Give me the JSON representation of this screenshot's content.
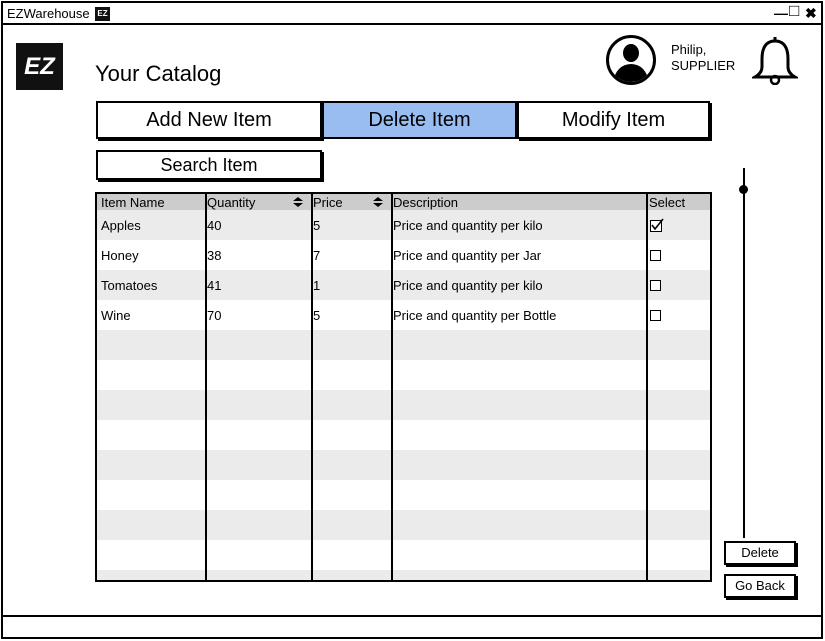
{
  "window": {
    "title": "EZWarehouse",
    "title_logo": "EZ",
    "minimize_glyph": "—",
    "maximize_glyph": "□",
    "close_glyph": "✖"
  },
  "header": {
    "logo": "EZ",
    "title": "Your Catalog",
    "user_name": "Philip,",
    "user_role": "SUPPLIER"
  },
  "actions": {
    "add": "Add New Item",
    "delete": "Delete Item",
    "modify": "Modify Item",
    "active": "delete"
  },
  "search": {
    "label": "Search Item"
  },
  "table": {
    "columns": [
      "Item Name",
      "Quantity",
      "Price",
      "Description",
      "Select"
    ],
    "sortable": [
      "Quantity",
      "Price"
    ],
    "rows": [
      {
        "name": "Apples",
        "quantity": "40",
        "price": "5",
        "description": "Price and quantity per kilo",
        "selected": true
      },
      {
        "name": "Honey",
        "quantity": "38",
        "price": "7",
        "description": "Price and quantity per Jar",
        "selected": false
      },
      {
        "name": "Tomatoes",
        "quantity": "41",
        "price": "1",
        "description": "Price and quantity per kilo",
        "selected": false
      },
      {
        "name": "Wine",
        "quantity": "70",
        "price": "5",
        "description": "Price and quantity per Bottle",
        "selected": false
      }
    ]
  },
  "buttons": {
    "delete": "Delete",
    "go_back": "Go Back"
  },
  "colors": {
    "active_tab": "#99bdf0",
    "header_row": "#cccccc",
    "alt_row": "#ebebeb"
  }
}
